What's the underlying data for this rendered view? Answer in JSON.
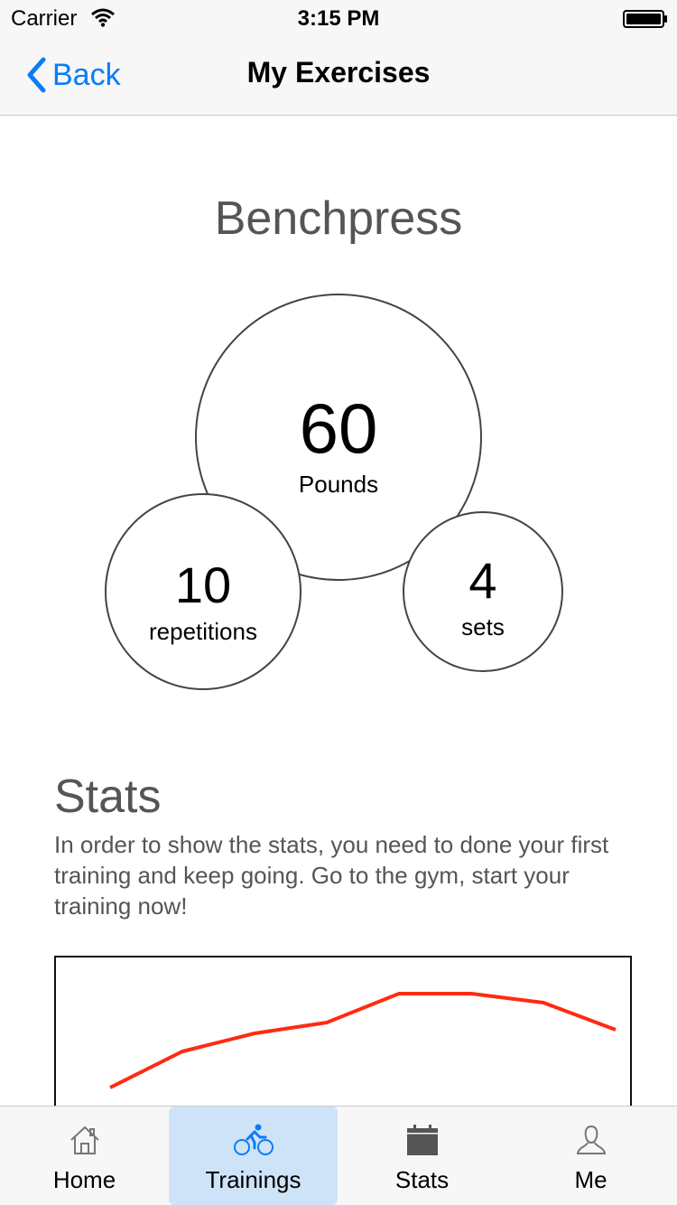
{
  "status_bar": {
    "carrier": "Carrier",
    "time": "3:15 PM",
    "icons": [
      "wifi-icon",
      "battery-icon"
    ]
  },
  "nav": {
    "back_label": "Back",
    "title": "My Exercises",
    "accent_color": "#0b7cf5"
  },
  "exercise": {
    "name": "Benchpress",
    "weight": {
      "value": "60",
      "unit": "Pounds"
    },
    "repetitions": {
      "value": "10",
      "unit": "repetitions"
    },
    "sets": {
      "value": "4",
      "unit": "sets"
    }
  },
  "stats": {
    "heading": "Stats",
    "message": "In order to show the stats, you need to done your first training and keep going. Go to the gym, start your training now!"
  },
  "chart_data": {
    "type": "line",
    "series": [
      {
        "values": [
          28,
          48,
          58,
          64,
          80,
          80,
          75,
          60
        ]
      }
    ],
    "line_color": "#ff2a12",
    "ylim": [
      0,
      100
    ],
    "grid": false
  },
  "tab_bar": {
    "active_color": "#cfe3f8",
    "icon_active_color": "#0b7cf5",
    "tabs": [
      {
        "label": "Home",
        "icon": "home-icon",
        "active": false
      },
      {
        "label": "Trainings",
        "icon": "bicycle-icon",
        "active": true
      },
      {
        "label": "Stats",
        "icon": "calendar-icon",
        "active": false
      },
      {
        "label": "Me",
        "icon": "person-icon",
        "active": false
      }
    ]
  }
}
